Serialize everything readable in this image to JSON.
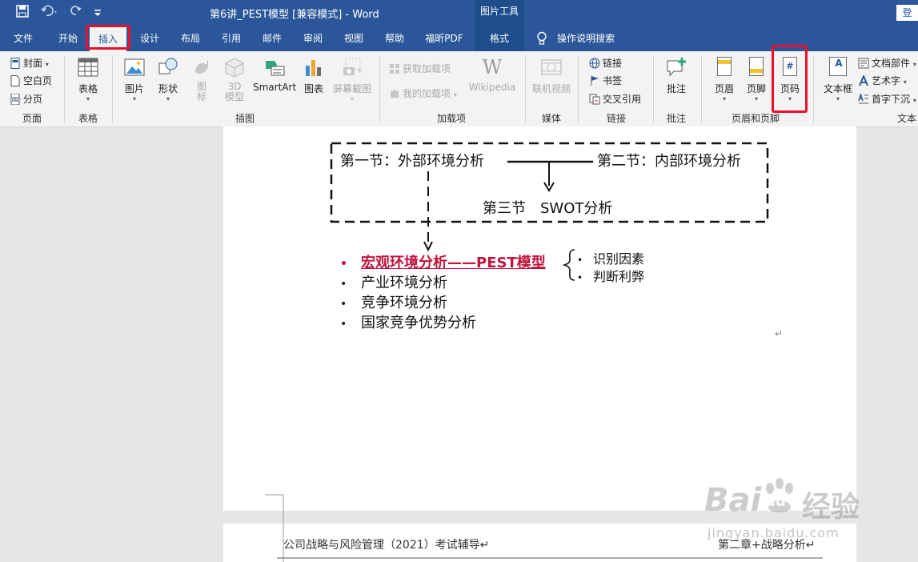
{
  "titlebar": {
    "doc_title": "第6讲_PEST模型 [兼容模式] - Word",
    "tool_header": "图片工具",
    "login": "登"
  },
  "tabs": [
    "文件",
    "开始",
    "插入",
    "设计",
    "布局",
    "引用",
    "邮件",
    "审阅",
    "视图",
    "帮助",
    "福昕PDF",
    "格式"
  ],
  "active_tab": "插入",
  "tell_me": "操作说明搜索",
  "ribbon": {
    "page_group": {
      "label": "页面",
      "cover": "封面",
      "blank_page": "空白页",
      "page_break": "分页"
    },
    "table_group": {
      "label": "表格",
      "table": "表格"
    },
    "illus_group": {
      "label": "插图",
      "picture": "图片",
      "shapes": "形状",
      "icons": "图\n标",
      "model3d": "3D\n模型",
      "smartart": "SmartArt",
      "chart": "图表",
      "screenshot": "屏幕截图"
    },
    "addins_group": {
      "label": "加载项",
      "get_addins": "获取加载项",
      "my_addins": "我的加载项",
      "wikipedia": "Wikipedia",
      "wikipedia_glyph": "W"
    },
    "media_group": {
      "label": "媒体",
      "online_video": "联机视频"
    },
    "links_group": {
      "label": "链接",
      "link": "链接",
      "bookmark": "书签",
      "cross_ref": "交叉引用"
    },
    "comments_group": {
      "label": "批注",
      "comment": "批注"
    },
    "hf_group": {
      "label": "页眉和页脚",
      "header": "页眉",
      "footer": "页脚",
      "page_number": "页码",
      "page_number_glyph": "#"
    },
    "text_group": {
      "label": "文本",
      "textbox": "文本框",
      "textbox_glyph": "A",
      "quick_parts": "文档部件",
      "wordart": "艺术字",
      "drop_cap": "首字下沉"
    }
  },
  "document": {
    "box_left": "第一节：外部环境分析",
    "box_right": "第二节：内部环境分析",
    "box_bottom": "第三节　SWOT分析",
    "bullets": [
      "宏观环境分析——PEST模型",
      "产业环境分析",
      "竞争环境分析",
      "国家竞争优势分析"
    ],
    "sub_bullets": [
      "识别因素",
      "判断利弊"
    ],
    "para_mark": "↵",
    "footer_left": "公司战略与风险管理（2021）考试辅导↵",
    "footer_right": "第二章+战略分析↵"
  },
  "watermark": {
    "brand": "Bai",
    "brand2": "du",
    "cn": "经验",
    "url": "jingyan.baidu.com"
  },
  "colors": {
    "word_blue": "#2b579a",
    "tool_tab": "#1e4d8c",
    "highlight_red": "#e8102a",
    "bullet_red": "#c0143c"
  }
}
